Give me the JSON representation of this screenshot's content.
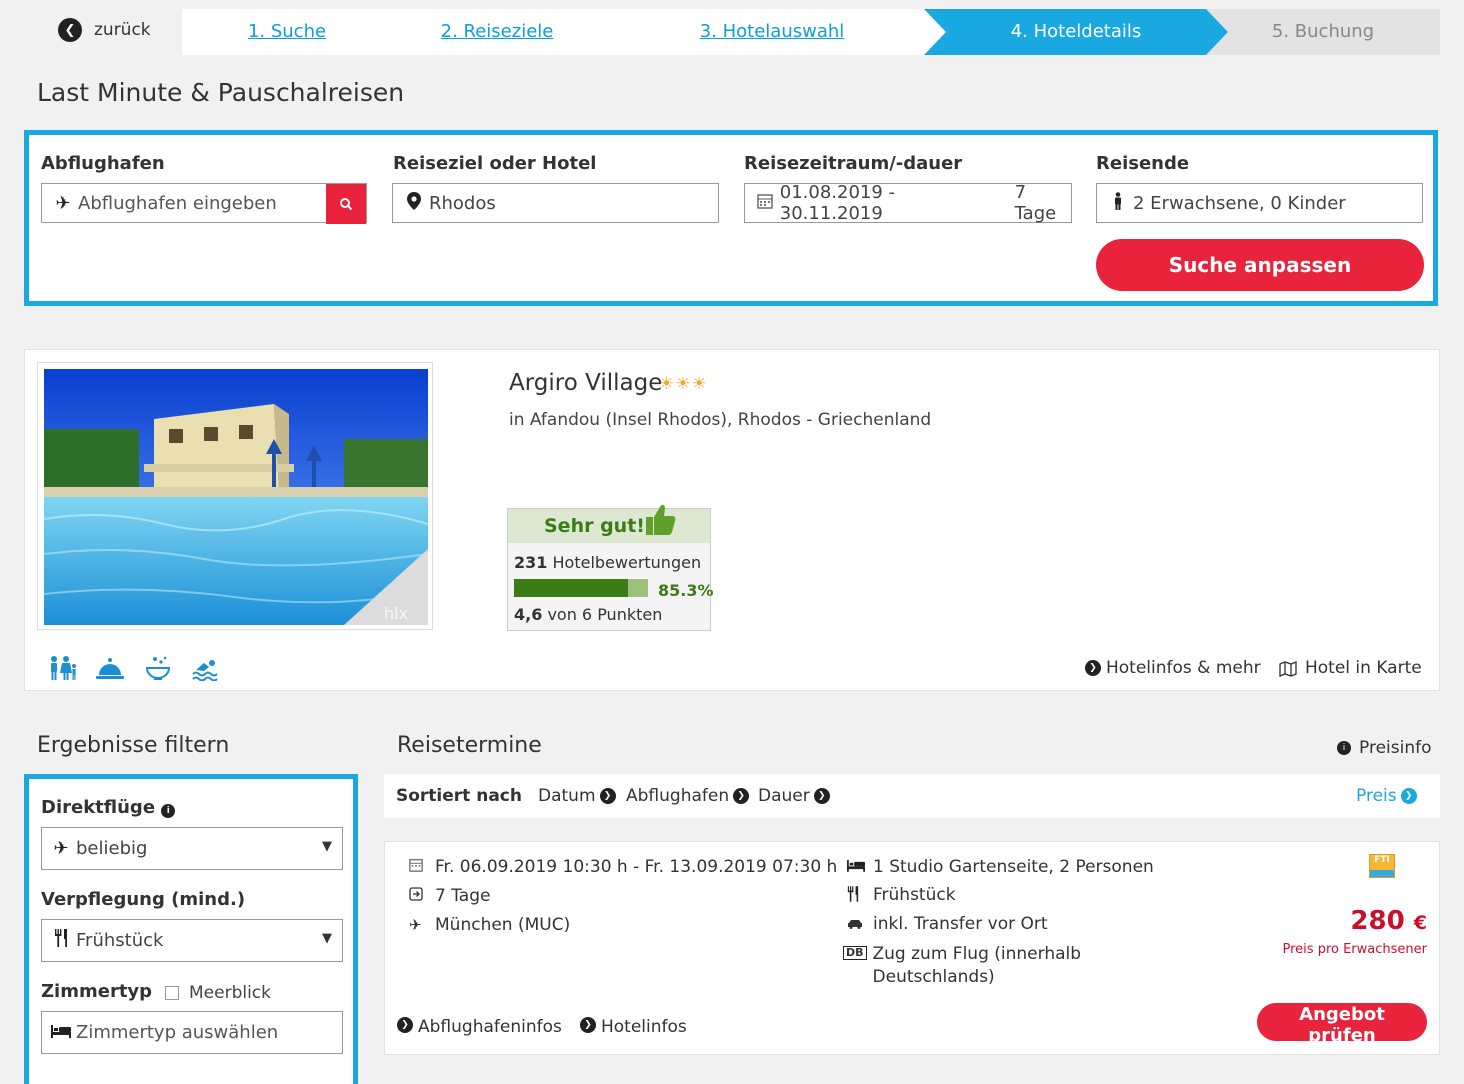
{
  "nav": {
    "back_label": "zurück",
    "steps": [
      "1. Suche",
      "2. Reiseziele",
      "3. Hotelauswahl",
      "4. Hoteldetails",
      "5. Buchung"
    ]
  },
  "page_title": "Last Minute & Pauschalreisen",
  "search": {
    "departure_label": "Abflughafen",
    "departure_placeholder": "Abflughafen eingeben",
    "destination_label": "Reiseziel oder Hotel",
    "destination_value": "Rhodos",
    "period_label": "Reisezeitraum/-dauer",
    "period_value": "01.08.2019 - 30.11.2019",
    "duration_value": "7 Tage",
    "travelers_label": "Reisende",
    "travelers_value": "2 Erwachsene, 0 Kinder",
    "submit_label": "Suche anpassen"
  },
  "hotel": {
    "name": "Argiro Village",
    "stars": "☀☀☀",
    "location": "in Afandou (Insel Rhodos), Rhodos - Griechenland",
    "photo_watermark": "hlx",
    "rating_label": "Sehr gut!",
    "review_count": "231",
    "review_label": "Hotelbewertungen",
    "recommend_pct": "85.3%",
    "recommend_fraction": 0.853,
    "score": "4,6",
    "score_label": "von 6 Punkten",
    "link_infos": "Hotelinfos & mehr",
    "link_map": "Hotel in Karte"
  },
  "filters": {
    "title": "Ergebnisse filtern",
    "direct_label": "Direktflüge",
    "direct_value": "beliebig",
    "board_label": "Verpflegung (mind.)",
    "board_value": "Frühstück",
    "room_label": "Zimmertyp",
    "seaview_label": "Meerblick",
    "room_placeholder": "Zimmertyp auswählen"
  },
  "results": {
    "title": "Reisetermine",
    "price_info": "Preisinfo",
    "sort_label": "Sortiert nach",
    "sort_options": [
      "Datum",
      "Abflughafen",
      "Dauer",
      "Preis"
    ]
  },
  "offer": {
    "dates": "Fr. 06.09.2019 10:30 h - Fr. 13.09.2019 07:30 h",
    "duration": "7 Tage",
    "airport": "München (MUC)",
    "room": "1 Studio Gartenseite, 2 Personen",
    "board": "Frühstück",
    "transfer": "inkl. Transfer vor Ort",
    "train_line1": "Zug zum Flug (innerhalb",
    "train_line2": "Deutschlands)",
    "train_badge": "DB",
    "operator_logo": "FTI",
    "price": "280",
    "currency": "€",
    "price_note": "Preis pro Erwachsener",
    "airport_info": "Abflughafeninfos",
    "hotel_info": "Hotelinfos",
    "cta": "Angebot prüfen"
  },
  "colors": {
    "accent_blue": "#1aa8e0",
    "cta_red": "#e8233b",
    "rating_green": "#3c7c16"
  }
}
